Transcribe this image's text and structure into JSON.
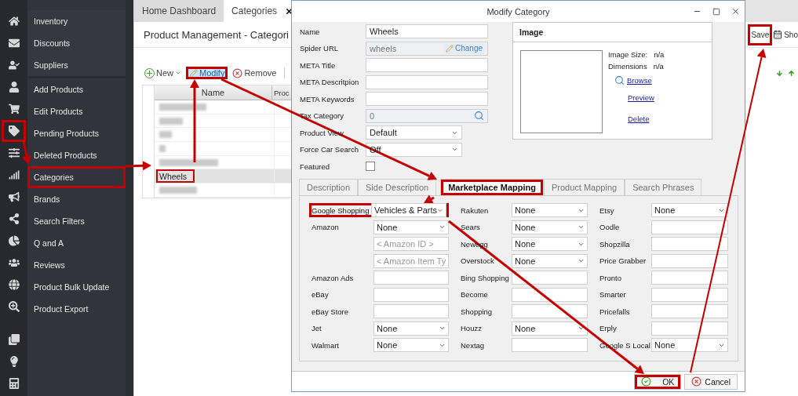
{
  "icon_rail": [
    {
      "annotated": false
    },
    {
      "annotated": false
    },
    {
      "annotated": false
    },
    {
      "annotated": false
    },
    {
      "annotated": false
    },
    {
      "annotated": true
    },
    {
      "annotated": false
    },
    {
      "annotated": false
    },
    {
      "annotated": false
    },
    {
      "annotated": false
    },
    {
      "annotated": false
    },
    {
      "annotated": false
    },
    {
      "annotated": false
    },
    {
      "annotated": false
    },
    {
      "annotated": false
    },
    {
      "annotated": false
    },
    {
      "annotated": false
    }
  ],
  "sidebar": {
    "sections": [
      {
        "items": [
          {
            "label": "Inventory",
            "annotated": false
          },
          {
            "label": "Discounts",
            "annotated": false
          },
          {
            "label": "Suppliers",
            "annotated": false
          }
        ]
      },
      {
        "items": [
          {
            "label": "Add Products",
            "annotated": false
          },
          {
            "label": "Edit Products",
            "annotated": false
          },
          {
            "label": "Pending Products",
            "annotated": false
          },
          {
            "label": "Deleted Products",
            "annotated": false
          },
          {
            "label": "Categories",
            "annotated": true
          },
          {
            "label": "Brands",
            "annotated": false
          },
          {
            "label": "Search Filters",
            "annotated": false
          },
          {
            "label": "Q and A",
            "annotated": false
          },
          {
            "label": "Reviews",
            "annotated": false
          },
          {
            "label": "Product Bulk Update",
            "annotated": false
          },
          {
            "label": "Product Export",
            "annotated": false
          }
        ]
      }
    ]
  },
  "tabs": [
    {
      "label": "Home Dashboard",
      "selected": false,
      "closable": false
    },
    {
      "label": "Categories",
      "selected": true,
      "closable": true
    }
  ],
  "page_title": "Product Management - Categori",
  "header_actions": [
    {
      "label": "Save",
      "annotated": true
    },
    {
      "label": "Sho",
      "annotated": false
    }
  ],
  "toolbar": [
    {
      "label": "New",
      "kind": "new",
      "annotated": false
    },
    {
      "label": "Modify",
      "kind": "modify",
      "annotated": true
    },
    {
      "label": "Remove",
      "kind": "remove",
      "annotated": false
    }
  ],
  "grid": {
    "columns": [
      "Name",
      "Proc"
    ],
    "rows": [
      {
        "kind": "blurred",
        "selected": false
      },
      {
        "kind": "blurred",
        "selected": false
      },
      {
        "kind": "blurred",
        "selected": false
      },
      {
        "kind": "blurred",
        "selected": false
      },
      {
        "kind": "blurred",
        "selected": false
      },
      {
        "kind": "text",
        "name": "Wheels",
        "selected": true,
        "annotated": true
      },
      {
        "kind": "blurred",
        "selected": false
      }
    ]
  },
  "dialog": {
    "title": "Modify Category",
    "fields": [
      {
        "label": "Name",
        "kind": "text",
        "value": "Wheels"
      },
      {
        "label": "Spider URL",
        "kind": "locked",
        "value": "wheels",
        "action": "Change"
      },
      {
        "label": "META Title",
        "kind": "text"
      },
      {
        "label": "META Descritpion",
        "kind": "text"
      },
      {
        "label": "META Keywords",
        "kind": "text"
      },
      {
        "label": "Tax Category",
        "kind": "search",
        "value": "0"
      },
      {
        "label": "Product View",
        "kind": "select",
        "value": "Default"
      },
      {
        "label": "Force Car Search",
        "kind": "select",
        "value": "Off"
      },
      {
        "label": "Featured",
        "kind": "checkbox",
        "checked": false
      }
    ],
    "image": {
      "title": "Image",
      "size_label": "Image Size:",
      "size": "n/a",
      "dimensions_label": "Dimensions",
      "dimensions": "n/a",
      "links": [
        "Browse",
        "Preview",
        "Delete"
      ]
    },
    "tabs": [
      {
        "label": "Description",
        "selected": false,
        "annotated": false
      },
      {
        "label": "Side Description",
        "selected": false,
        "annotated": false
      },
      {
        "label": "Marketplace Mapping",
        "selected": true,
        "annotated": true
      },
      {
        "label": "Product Mapping",
        "selected": false,
        "annotated": false
      },
      {
        "label": "Search Phrases",
        "selected": false,
        "annotated": false
      }
    ],
    "mapping": [
      [
        {
          "label": "Google Shopping",
          "kind": "select",
          "value": "Vehicles & Parts",
          "annotated": true
        },
        {
          "label": "Amazon",
          "kind": "select",
          "value": "None",
          "annotated": false
        },
        {
          "kind": "text",
          "placeholder": "< Amazon ID >",
          "annotated": false
        },
        {
          "kind": "text",
          "placeholder": "< Amazon Item Ty",
          "annotated": false
        },
        {
          "label": "Amazon Ads",
          "kind": "text",
          "annotated": false
        },
        {
          "label": "eBay",
          "kind": "text",
          "annotated": false
        },
        {
          "label": "eBay Store",
          "kind": "text",
          "annotated": false
        },
        {
          "label": "Jet",
          "kind": "select",
          "value": "None",
          "annotated": false
        },
        {
          "label": "Walmart",
          "kind": "select",
          "value": "None",
          "annotated": false
        }
      ],
      [
        {
          "label": "Rakuten",
          "kind": "select",
          "value": "None",
          "annotated": false
        },
        {
          "label": "Sears",
          "kind": "select",
          "value": "None",
          "annotated": false
        },
        {
          "label": "Newegg",
          "kind": "select",
          "value": "None",
          "annotated": false
        },
        {
          "label": "Overstock",
          "kind": "select",
          "value": "None",
          "annotated": false
        },
        {
          "label": "Bing Shopping",
          "kind": "text",
          "annotated": false
        },
        {
          "label": "Become",
          "kind": "text",
          "annotated": false
        },
        {
          "label": "Shopping",
          "kind": "text",
          "annotated": false
        },
        {
          "label": "Houzz",
          "kind": "select",
          "value": "None",
          "annotated": false
        },
        {
          "label": "Nextag",
          "kind": "text",
          "annotated": false
        }
      ],
      [
        {
          "label": "Etsy",
          "kind": "select",
          "value": "None",
          "annotated": false
        },
        {
          "label": "Oodle",
          "kind": "text",
          "annotated": false
        },
        {
          "label": "Shopzilla",
          "kind": "text",
          "annotated": false
        },
        {
          "label": "Price Grabber",
          "kind": "text",
          "annotated": false
        },
        {
          "label": "Pronto",
          "kind": "text",
          "annotated": false
        },
        {
          "label": "Smarter",
          "kind": "text",
          "annotated": false
        },
        {
          "label": "Pricefalls",
          "kind": "text",
          "annotated": false
        },
        {
          "label": "Erply",
          "kind": "text",
          "annotated": false
        },
        {
          "label": "Google S Local",
          "kind": "select",
          "value": "None",
          "annotated": false
        }
      ]
    ],
    "buttons": [
      {
        "label": "OK",
        "kind": "ok",
        "annotated": true
      },
      {
        "label": "Cancel",
        "kind": "cancel",
        "annotated": false
      }
    ]
  }
}
